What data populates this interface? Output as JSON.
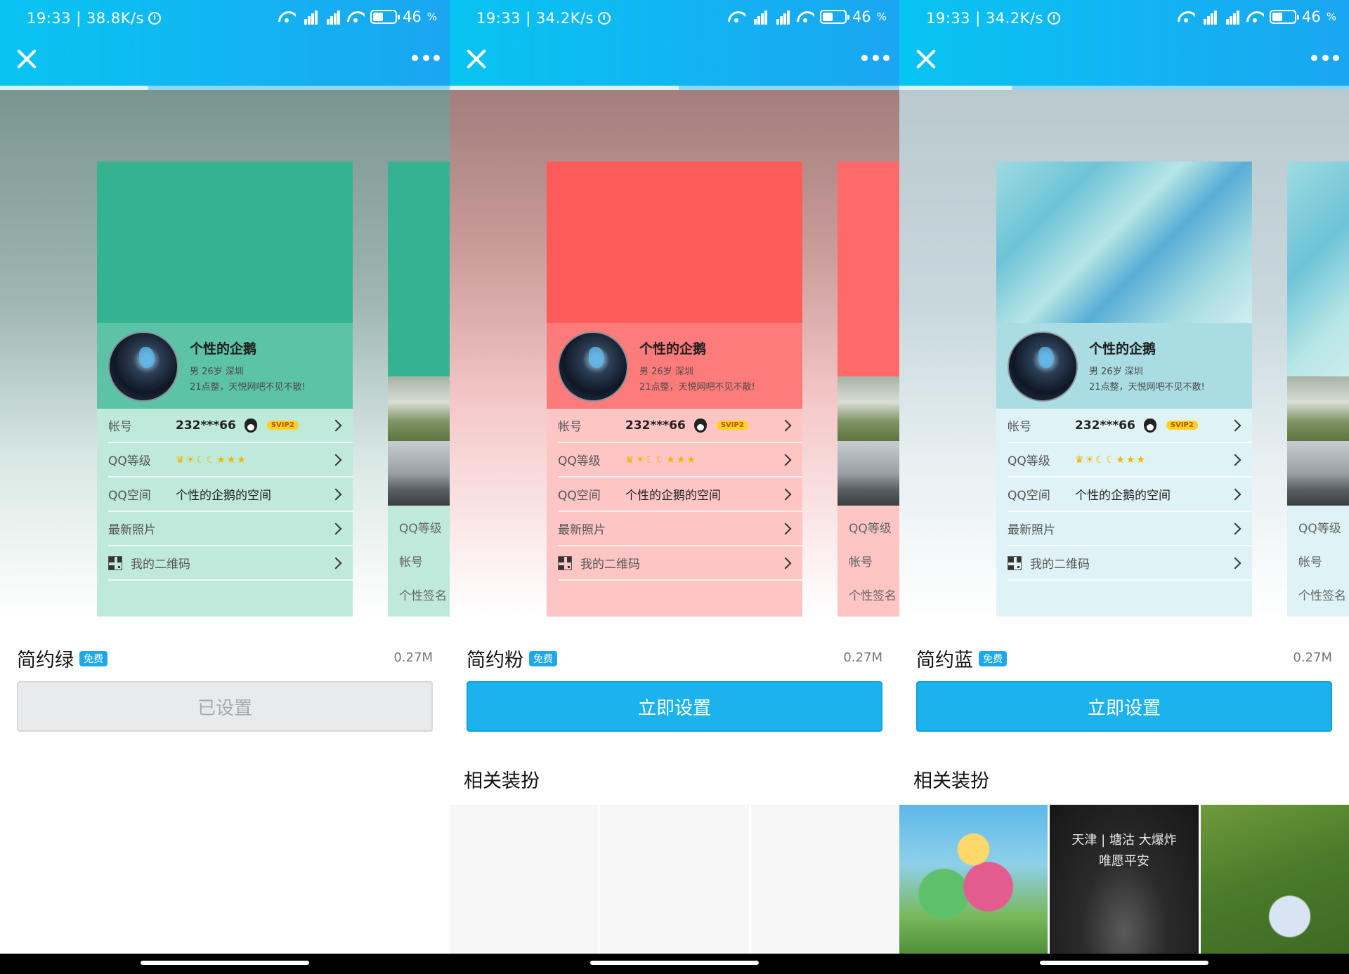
{
  "screens": [
    {
      "id": "green",
      "status": {
        "time_speed": "19:33 | 38.8K/s",
        "battery": "46",
        "battery_unit": "%"
      },
      "progress": 0.33,
      "card": {
        "top_color": "#35b390",
        "profile_color": "#5dc3a6",
        "rows_color": "#bfe9db",
        "nickname": "个性的企鹅",
        "info": "男  26岁  深圳",
        "signature": "21点整，天悦网吧不见不散!",
        "rows": [
          {
            "label": "帐号",
            "value": "232***66",
            "badge": "SVIP2"
          },
          {
            "label": "QQ等级",
            "value": ""
          },
          {
            "label": "QQ空间",
            "value": "个性的企鹅的空间"
          },
          {
            "label": "最新照片",
            "value": ""
          },
          {
            "label": "我的二维码",
            "value": ""
          }
        ]
      },
      "next_card": {
        "top_color": "#35b390",
        "rows_color": "#bfe9db",
        "labels": [
          "QQ等级",
          "帐号",
          "个性签名"
        ]
      },
      "background": "linear-gradient(180deg,#7a9590 0%,#9fb6b1 40%,#d9e8e4 70%,#ffffff 100%)",
      "theme": {
        "name": "简约绿",
        "badge": "免费",
        "size": "0.27M",
        "button_label": "已设置",
        "button_state": "done"
      },
      "related": null
    },
    {
      "id": "pink",
      "status": {
        "time_speed": "19:33 | 34.2K/s",
        "battery": "46",
        "battery_unit": "%"
      },
      "progress": 0.51,
      "card": {
        "top_color": "#fe5b5b",
        "profile_color": "#fe7b7b",
        "rows_color": "#fec5c5",
        "nickname": "个性的企鹅",
        "info": "男  26岁  深圳",
        "signature": "21点整，天悦网吧不见不散!",
        "rows": [
          {
            "label": "帐号",
            "value": "232***66",
            "badge": "SVIP2"
          },
          {
            "label": "QQ等级",
            "value": ""
          },
          {
            "label": "QQ空间",
            "value": "个性的企鹅的空间"
          },
          {
            "label": "最新照片",
            "value": ""
          },
          {
            "label": "我的二维码",
            "value": ""
          }
        ]
      },
      "next_card": {
        "top_color": "#fe6a6a",
        "rows_color": "#fec5c5",
        "labels": [
          "QQ等级",
          "帐号",
          "个性签名"
        ]
      },
      "background": "linear-gradient(180deg,#a27e7c 0%,#c99b99 30%,#f5c9c9 60%,#ffffff 100%)",
      "theme": {
        "name": "简约粉",
        "badge": "免费",
        "size": "0.27M",
        "button_label": "立即设置",
        "button_state": "primary"
      },
      "related": {
        "title": "相关装扮",
        "items": [
          "",
          "",
          ""
        ]
      }
    },
    {
      "id": "blue",
      "status": {
        "time_speed": "19:33 | 34.2K/s",
        "battery": "46",
        "battery_unit": "%"
      },
      "progress": 0.25,
      "card": {
        "top_color": "#8fd0d9",
        "profile_color": "#a9dce3",
        "rows_color": "#dff2f5",
        "nickname": "个性的企鹅",
        "info": "男  26岁  深圳",
        "signature": "21点整，天悦网吧不见不散!",
        "rows": [
          {
            "label": "帐号",
            "value": "232***66",
            "badge": "SVIP2"
          },
          {
            "label": "QQ等级",
            "value": ""
          },
          {
            "label": "QQ空间",
            "value": "个性的企鹅的空间"
          },
          {
            "label": "最新照片",
            "value": ""
          },
          {
            "label": "我的二维码",
            "value": ""
          }
        ]
      },
      "next_card": {
        "top_color": "#8fd0d9",
        "rows_color": "#dff2f5",
        "labels": [
          "QQ等级",
          "帐号",
          "个性签名"
        ]
      },
      "background": "linear-gradient(180deg,#b9c9ce 0%,#c7d7dc 40%,#e6eff1 70%,#ffffff 100%)",
      "theme": {
        "name": "简约蓝",
        "badge": "免费",
        "size": "0.27M",
        "button_label": "立即设置",
        "button_state": "primary"
      },
      "related": {
        "title": "相关装扮",
        "items": [
          "",
          "天津 | 塘沽  大爆炸  唯愿平安",
          ""
        ]
      }
    }
  ]
}
